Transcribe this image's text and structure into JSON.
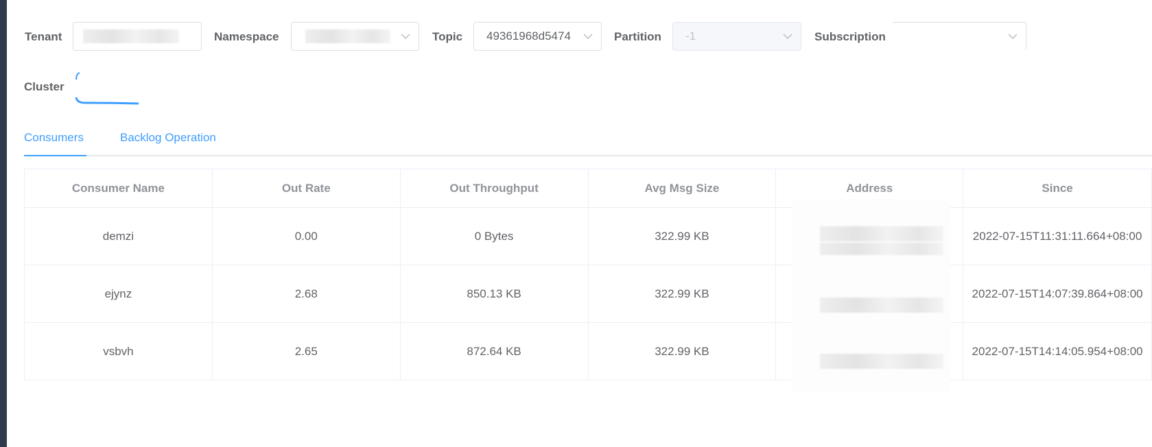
{
  "filters": {
    "tenant": {
      "label": "Tenant",
      "value": ""
    },
    "namespace": {
      "label": "Namespace",
      "value": ""
    },
    "topic": {
      "label": "Topic",
      "value": "49361968d5474"
    },
    "partition": {
      "label": "Partition",
      "value": "-1",
      "disabled": true
    },
    "subscription": {
      "label": "Subscription",
      "value": ""
    },
    "cluster": {
      "label": "Cluster"
    }
  },
  "tabs": [
    {
      "label": "Consumers",
      "active": true
    },
    {
      "label": "Backlog Operation",
      "active": false
    }
  ],
  "table": {
    "columns": [
      "Consumer Name",
      "Out Rate",
      "Out Throughput",
      "Avg Msg Size",
      "Address",
      "Since"
    ],
    "rows": [
      {
        "name": "demzi",
        "out_rate": "0.00",
        "out_throughput": "0 Bytes",
        "avg_msg_size": "322.99 KB",
        "address": "",
        "since": "2022-07-15T11:31:11.664+08:00"
      },
      {
        "name": "ejynz",
        "out_rate": "2.68",
        "out_throughput": "850.13 KB",
        "avg_msg_size": "322.99 KB",
        "address": "",
        "since": "2022-07-15T14:07:39.864+08:00"
      },
      {
        "name": "vsbvh",
        "out_rate": "2.65",
        "out_throughput": "872.64 KB",
        "avg_msg_size": "322.99 KB",
        "address": "",
        "since": "2022-07-15T14:14:05.954+08:00"
      }
    ]
  },
  "colors": {
    "accent": "#409eff",
    "border": "#dcdfe6",
    "text": "#606266",
    "header_text": "#909399"
  },
  "icons": {
    "select_arrow": "chevron-down-icon"
  }
}
